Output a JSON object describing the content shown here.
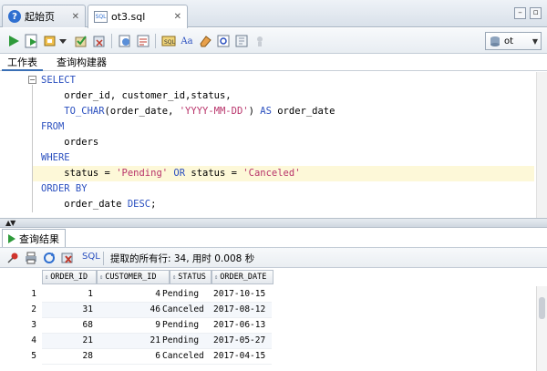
{
  "tabs": [
    {
      "label": "起始页",
      "icon": "help-icon",
      "active": false
    },
    {
      "label": "ot3.sql",
      "icon": "sql-file-icon",
      "active": true
    }
  ],
  "toolbar": {
    "connection": "ot"
  },
  "subtabs": [
    "工作表",
    "查询构建器"
  ],
  "editor": {
    "lines": [
      [
        {
          "t": "SELECT",
          "c": "kw"
        }
      ],
      [
        {
          "t": "    order_id, customer_id,status,",
          "c": "plain"
        }
      ],
      [
        {
          "t": "    TO_CHAR",
          "c": "kw"
        },
        {
          "t": "(order_date, ",
          "c": "plain"
        },
        {
          "t": "'YYYY-MM-DD'",
          "c": "str"
        },
        {
          "t": ") ",
          "c": "plain"
        },
        {
          "t": "AS",
          "c": "kw"
        },
        {
          "t": " order_date",
          "c": "plain"
        }
      ],
      [
        {
          "t": "FROM",
          "c": "kw"
        }
      ],
      [
        {
          "t": "    orders",
          "c": "plain"
        }
      ],
      [
        {
          "t": "WHERE",
          "c": "kw"
        }
      ],
      [
        {
          "t": "    status = ",
          "c": "plain"
        },
        {
          "t": "'Pending'",
          "c": "str"
        },
        {
          "t": " ",
          "c": "plain"
        },
        {
          "t": "OR",
          "c": "kw"
        },
        {
          "t": " status = ",
          "c": "plain"
        },
        {
          "t": "'Canceled'",
          "c": "str"
        }
      ],
      [
        {
          "t": "ORDER BY",
          "c": "kw"
        }
      ],
      [
        {
          "t": "    order_date ",
          "c": "plain"
        },
        {
          "t": "DESC",
          "c": "kw"
        },
        {
          "t": ";",
          "c": "plain"
        }
      ]
    ],
    "highlighted_line": 6
  },
  "results": {
    "tab_label": "查询结果",
    "sql_label": "SQL",
    "status": "提取的所有行: 34, 用时 0.008 秒",
    "columns": [
      "ORDER_ID",
      "CUSTOMER_ID",
      "STATUS",
      "ORDER_DATE"
    ],
    "rows": [
      {
        "n": "1",
        "order_id": "1",
        "customer_id": "4",
        "status": "Pending",
        "order_date": "2017-10-15"
      },
      {
        "n": "2",
        "order_id": "31",
        "customer_id": "46",
        "status": "Canceled",
        "order_date": "2017-08-12"
      },
      {
        "n": "3",
        "order_id": "68",
        "customer_id": "9",
        "status": "Pending",
        "order_date": "2017-06-13"
      },
      {
        "n": "4",
        "order_id": "21",
        "customer_id": "21",
        "status": "Pending",
        "order_date": "2017-05-27"
      },
      {
        "n": "5",
        "order_id": "28",
        "customer_id": "6",
        "status": "Canceled",
        "order_date": "2017-04-15"
      }
    ]
  },
  "colors": {
    "keyword": "#2a4fbf",
    "string": "#b8336a",
    "highlight_line": "#fdf8d8",
    "run_green": "#2e9a3a"
  }
}
